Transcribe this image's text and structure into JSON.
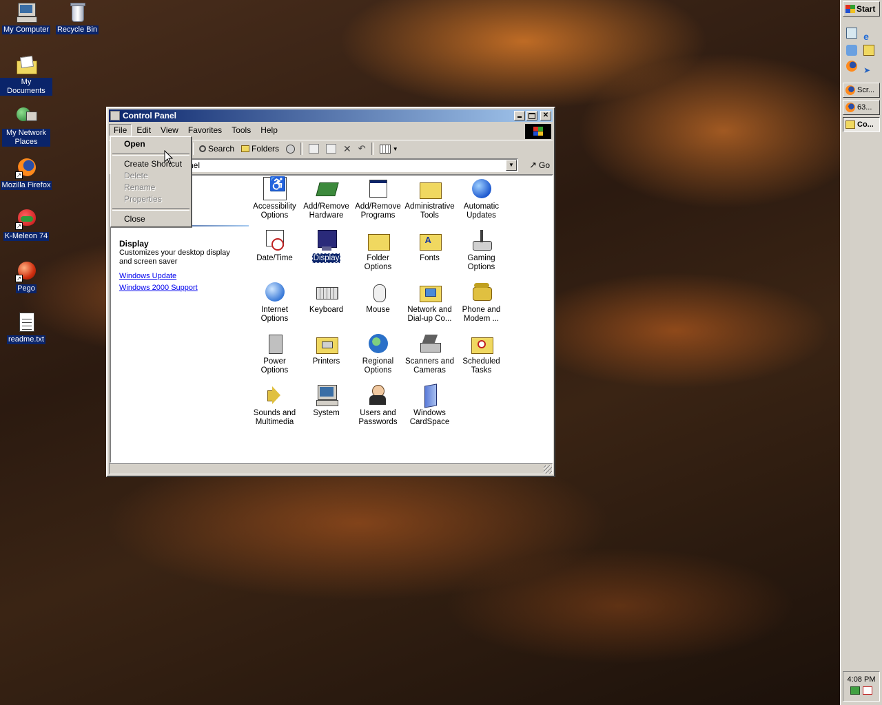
{
  "desktop": {
    "icons": [
      {
        "label": "My Computer",
        "icon": "computer-icon"
      },
      {
        "label": "Recycle Bin",
        "icon": "recycle-bin-icon"
      },
      {
        "label": "My Documents",
        "icon": "folder-documents-icon"
      },
      {
        "label": "My Network Places",
        "icon": "network-icon"
      },
      {
        "label": "Mozilla Firefox",
        "icon": "firefox-icon"
      },
      {
        "label": "K-Meleon 74",
        "icon": "kmeleon-icon"
      },
      {
        "label": "Pego",
        "icon": "pego-icon"
      },
      {
        "label": "readme.txt",
        "icon": "text-file-icon"
      }
    ]
  },
  "taskbar": {
    "start_label": "Start",
    "tasks": [
      {
        "label": "Scr..."
      },
      {
        "label": "63..."
      },
      {
        "label": "Co..."
      }
    ],
    "clock": "4:08 PM"
  },
  "window": {
    "title": "Control Panel",
    "menu": [
      "File",
      "Edit",
      "View",
      "Favorites",
      "Tools",
      "Help"
    ],
    "toolbar": {
      "search": "Search",
      "folders": "Folders"
    },
    "address_value": "nel",
    "go_label": "Go"
  },
  "file_menu": {
    "items": [
      "Open",
      "Create Shortcut",
      "Delete",
      "Rename",
      "Properties",
      "Close"
    ]
  },
  "info_pane": {
    "title_fragment": "l",
    "heading": "Display",
    "description": "Customizes your desktop display and screen saver",
    "links": [
      "Windows Update",
      "Windows 2000 Support"
    ]
  },
  "control_panel_items": [
    {
      "label": "Accessibility Options"
    },
    {
      "label": "Add/Remove Hardware"
    },
    {
      "label": "Add/Remove Programs"
    },
    {
      "label": "Administrative Tools"
    },
    {
      "label": "Automatic Updates"
    },
    {
      "label": "Date/Time"
    },
    {
      "label": "Display"
    },
    {
      "label": "Folder Options"
    },
    {
      "label": "Fonts"
    },
    {
      "label": "Gaming Options"
    },
    {
      "label": "Internet Options"
    },
    {
      "label": "Keyboard"
    },
    {
      "label": "Mouse"
    },
    {
      "label": "Network and Dial-up Co..."
    },
    {
      "label": "Phone and Modem ..."
    },
    {
      "label": "Power Options"
    },
    {
      "label": "Printers"
    },
    {
      "label": "Regional Options"
    },
    {
      "label": "Scanners and Cameras"
    },
    {
      "label": "Scheduled Tasks"
    },
    {
      "label": "Sounds and Multimedia"
    },
    {
      "label": "System"
    },
    {
      "label": "Users and Passwords"
    },
    {
      "label": "Windows CardSpace"
    }
  ]
}
